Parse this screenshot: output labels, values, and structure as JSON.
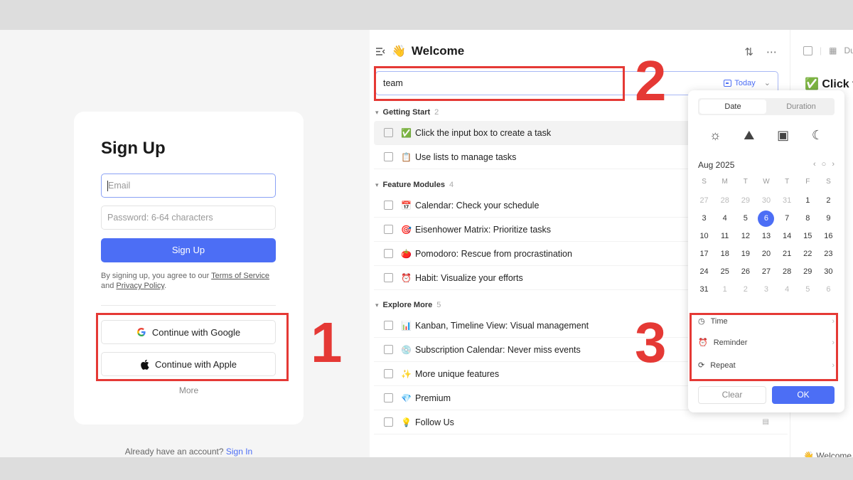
{
  "signup": {
    "title": "Sign Up",
    "email_placeholder": "Email",
    "password_placeholder": "Password: 6-64 characters",
    "submit_label": "Sign Up",
    "terms_prefix": "By signing up, you agree to our ",
    "terms_link": "Terms of Service",
    "terms_and": "and ",
    "privacy_link": "Privacy Policy",
    "terms_suffix": ".",
    "google_label": "Continue with Google",
    "apple_label": "Continue with Apple",
    "more_label": "More",
    "signin_prompt": "Already have an account? ",
    "signin_link": "Sign In"
  },
  "annotations": [
    "1",
    "2",
    "3"
  ],
  "task_list": {
    "title": "Welcome",
    "input_value": "team",
    "date_chip": "Today",
    "sections": [
      {
        "name": "Getting Start",
        "count": "2",
        "tasks": [
          {
            "emoji": "✅",
            "label": "Click the input box to create a task"
          },
          {
            "emoji": "📋",
            "label": "Use lists to manage tasks"
          }
        ]
      },
      {
        "name": "Feature Modules",
        "count": "4",
        "tasks": [
          {
            "emoji": "📅",
            "label": "Calendar: Check your schedule"
          },
          {
            "emoji": "🎯",
            "label": "Eisenhower Matrix: Prioritize tasks"
          },
          {
            "emoji": "🍅",
            "label": "Pomodoro: Rescue from procrastination"
          },
          {
            "emoji": "⏰",
            "label": "Habit: Visualize your efforts"
          }
        ]
      },
      {
        "name": "Explore More",
        "count": "5",
        "tasks": [
          {
            "emoji": "📊",
            "label": "Kanban, Timeline View: Visual management"
          },
          {
            "emoji": "💿",
            "label": "Subscription Calendar: Never miss events"
          },
          {
            "emoji": "✨",
            "label": "More unique features"
          },
          {
            "emoji": "💎",
            "label": "Premium"
          },
          {
            "emoji": "💡",
            "label": "Follow Us"
          }
        ]
      }
    ]
  },
  "detail_panel": {
    "due_label": "Due",
    "task_title": "Click t",
    "footer": "Welcome"
  },
  "date_picker": {
    "tab_date": "Date",
    "tab_duration": "Duration",
    "month_label": "Aug 2025",
    "weekdays": [
      "S",
      "M",
      "T",
      "W",
      "T",
      "F",
      "S"
    ],
    "days": [
      [
        "27",
        "28",
        "29",
        "30",
        "31",
        "1",
        "2"
      ],
      [
        "3",
        "4",
        "5",
        "6",
        "7",
        "8",
        "9"
      ],
      [
        "10",
        "11",
        "12",
        "13",
        "14",
        "15",
        "16"
      ],
      [
        "17",
        "18",
        "19",
        "20",
        "21",
        "22",
        "23"
      ],
      [
        "24",
        "25",
        "26",
        "27",
        "28",
        "29",
        "30"
      ],
      [
        "31",
        "1",
        "2",
        "3",
        "4",
        "5",
        "6"
      ]
    ],
    "selected_day": "6",
    "options": [
      {
        "label": "Time",
        "icon": "clock-icon"
      },
      {
        "label": "Reminder",
        "icon": "alarm-icon"
      },
      {
        "label": "Repeat",
        "icon": "repeat-icon"
      }
    ],
    "clear_label": "Clear",
    "ok_label": "OK"
  },
  "colors": {
    "accent": "#4c6ef5",
    "annotation_red": "#e53935"
  }
}
